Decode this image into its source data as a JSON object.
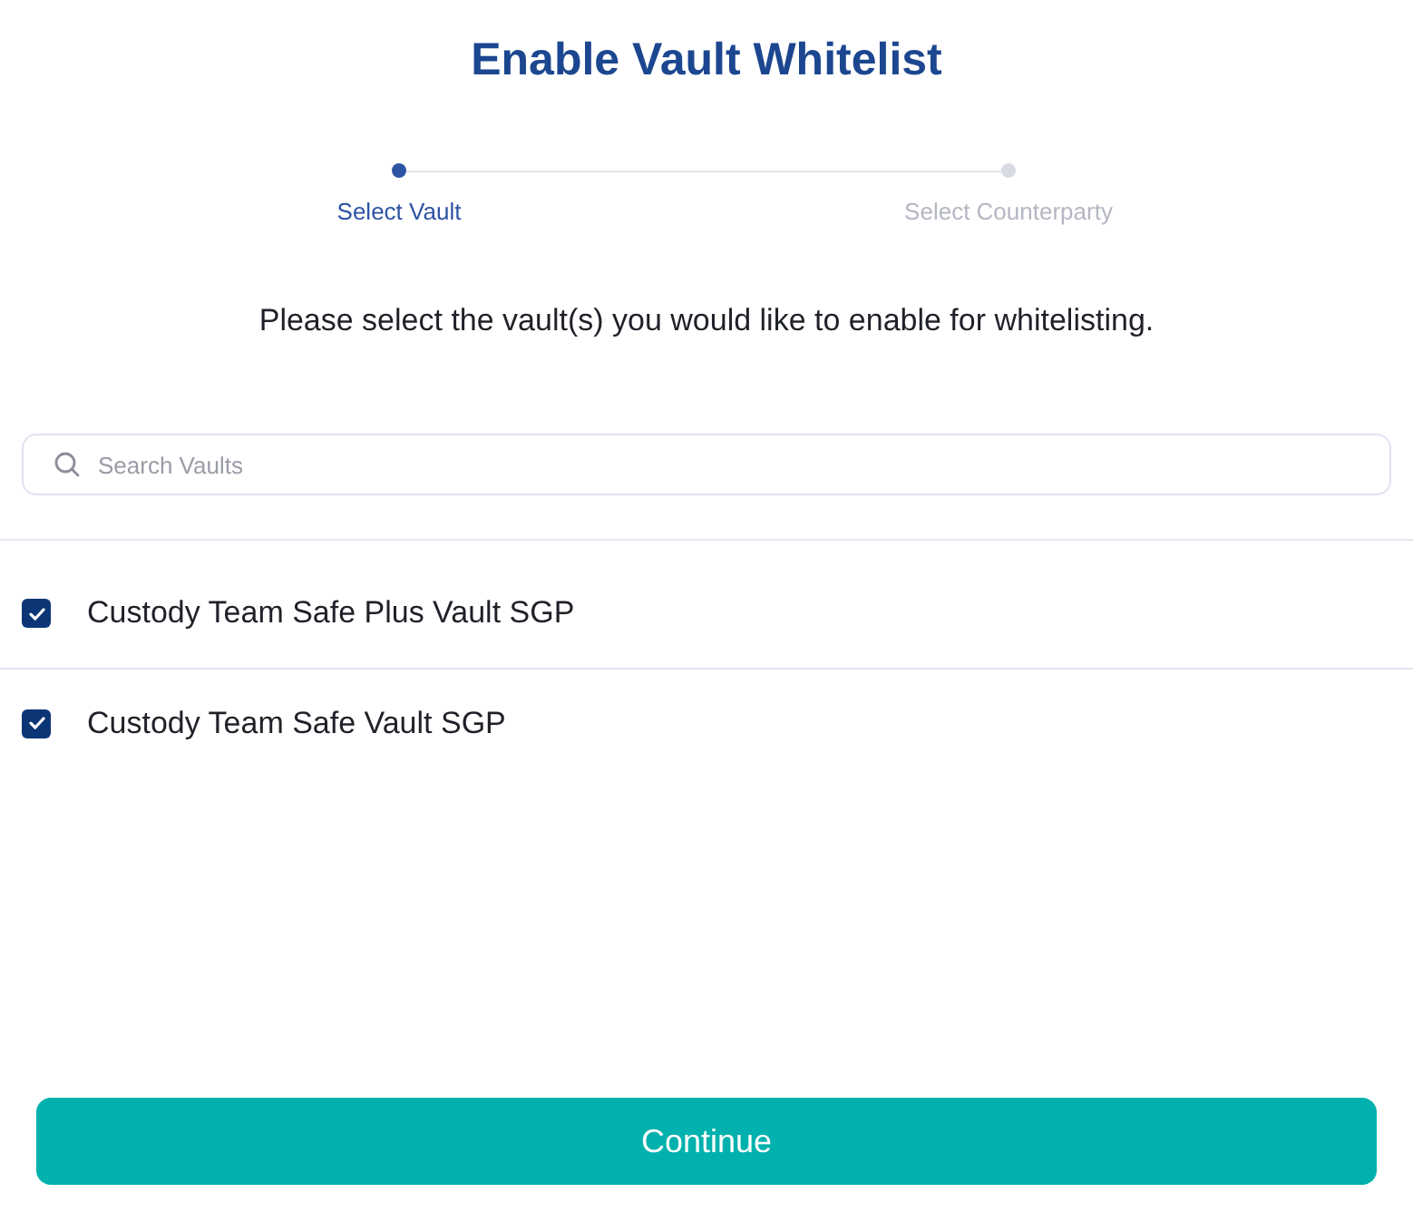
{
  "title": "Enable Vault Whitelist",
  "steps": [
    {
      "label": "Select Vault",
      "active": true
    },
    {
      "label": "Select Counterparty",
      "active": false
    }
  ],
  "instruction": "Please select the vault(s) you would like to enable for whitelisting.",
  "search": {
    "placeholder": "Search Vaults"
  },
  "vaults": [
    {
      "name": "Custody Team Safe Plus Vault SGP",
      "checked": true
    },
    {
      "name": "Custody Team Safe Vault SGP",
      "checked": true
    }
  ],
  "primary_button": {
    "label": "Continue"
  }
}
